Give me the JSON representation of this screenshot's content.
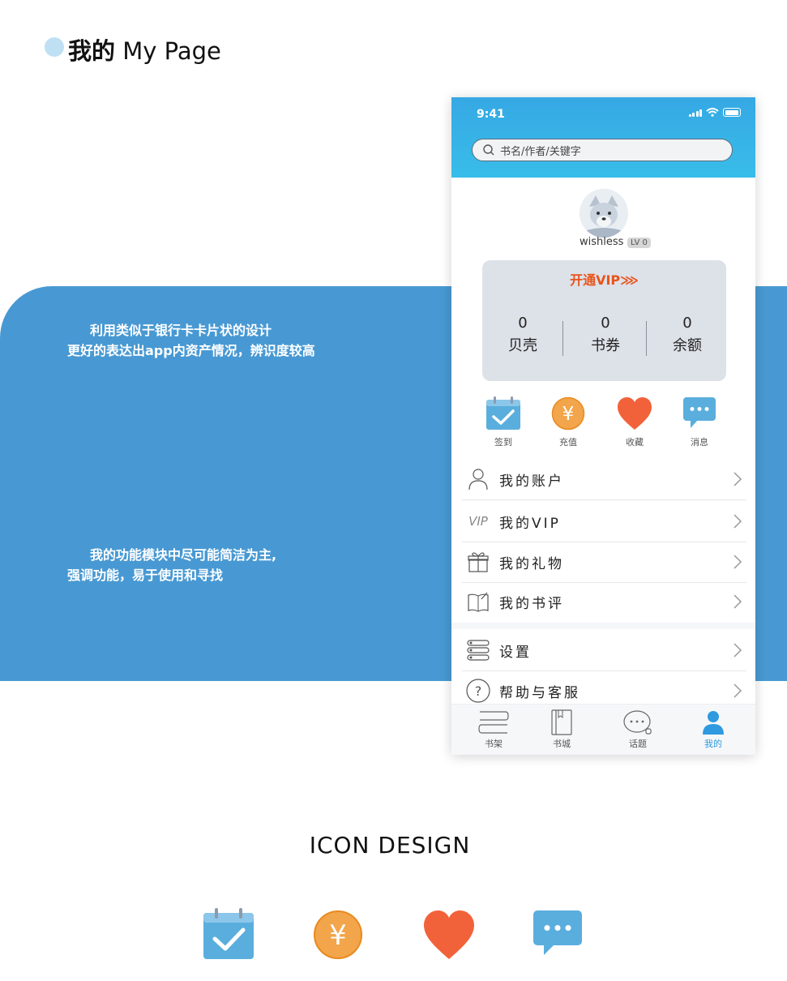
{
  "header": {
    "title_cn": "我的",
    "title_en": "My Page"
  },
  "band": {
    "text1_line1": "利用类似于银行卡卡片状的设计",
    "text1_line2": "更好的表达出app内资产情况，辨识度较高",
    "text2_line1": "我的功能模块中尽可能简洁为主,",
    "text2_line2": "强调功能，易于使用和寻找"
  },
  "phone": {
    "status": {
      "time": "9:41"
    },
    "search": {
      "placeholder": "书名/作者/关键字",
      "icon": "search-icon"
    },
    "profile": {
      "username": "wishless",
      "level": "LV 0"
    },
    "card": {
      "vip_label": "开通VIP⋙",
      "assets": [
        {
          "value": "0",
          "label": "贝壳"
        },
        {
          "value": "0",
          "label": "书券"
        },
        {
          "value": "0",
          "label": "余额"
        }
      ]
    },
    "quick_actions": [
      {
        "label": "签到",
        "icon": "calendar-check-icon"
      },
      {
        "label": "充值",
        "icon": "yen-coin-icon"
      },
      {
        "label": "收藏",
        "icon": "heart-icon"
      },
      {
        "label": "消息",
        "icon": "message-icon"
      }
    ],
    "menu": [
      {
        "label": "我的账户",
        "icon": "user-icon"
      },
      {
        "label": "我的VIP",
        "icon_text": "VIP",
        "icon": "vip-icon"
      },
      {
        "label": "我的礼物",
        "icon": "gift-icon"
      },
      {
        "label": "我的书评",
        "icon": "review-book-icon"
      },
      {
        "label": "设置",
        "icon": "settings-icon"
      },
      {
        "label": "帮助与客服",
        "icon": "help-icon"
      }
    ],
    "tabs": [
      {
        "label": "书架",
        "icon": "bookshelf-icon",
        "active": false
      },
      {
        "label": "书城",
        "icon": "book-icon",
        "active": false
      },
      {
        "label": "话题",
        "icon": "chat-icon",
        "active": false
      },
      {
        "label": "我的",
        "icon": "person-icon",
        "active": true
      }
    ]
  },
  "icon_design": {
    "title": "ICON DESIGN"
  },
  "colors": {
    "accent_blue": "#4899d3",
    "topbar_blue": "#36a8e4",
    "vip_orange": "#e8541b",
    "heart": "#f2623a",
    "coin": "#f2a54a",
    "calendar": "#5aaedd",
    "active_tab": "#2f9ae0"
  }
}
